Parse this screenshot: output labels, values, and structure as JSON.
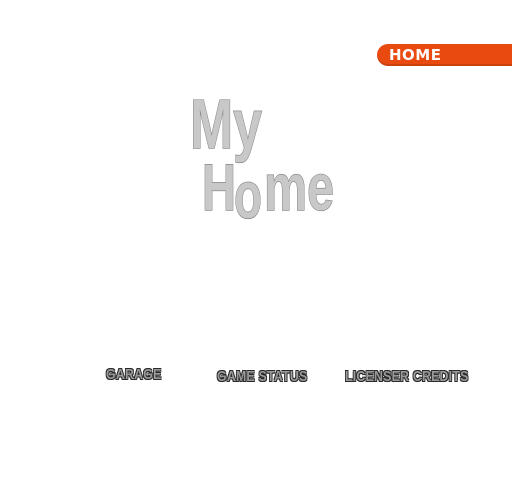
{
  "header": {
    "tab_label": "HOME",
    "tab_color": "#e84a10"
  },
  "title": {
    "line1": "My",
    "line2_first": "H",
    "line2_o": "o",
    "line2_rest": "me"
  },
  "menu": {
    "items": [
      {
        "label": "GARAGE"
      },
      {
        "label": "GAME STATUS"
      },
      {
        "label": "LICENSER CREDITS"
      }
    ]
  }
}
